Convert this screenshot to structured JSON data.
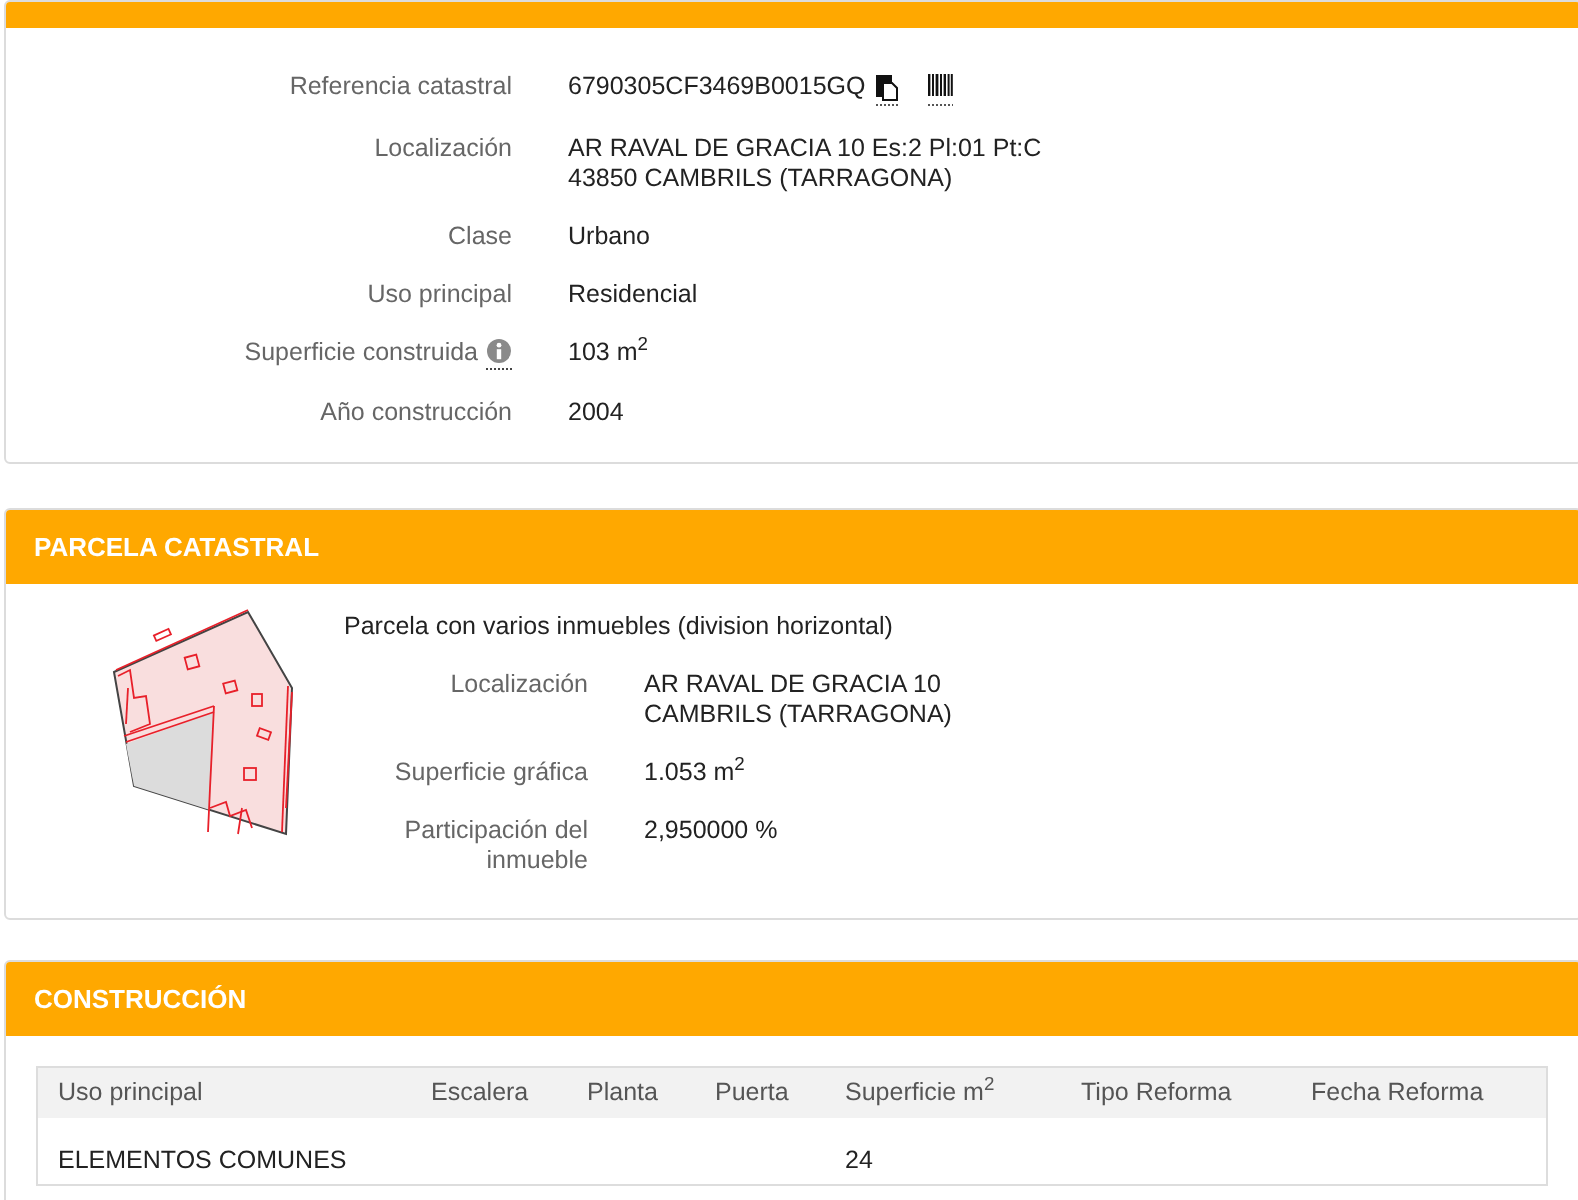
{
  "property": {
    "fields": [
      {
        "kind": "reference",
        "label": "Referencia catastral",
        "lines": [
          "6790305CF3469B0015GQ"
        ]
      },
      {
        "kind": "text",
        "label": "Localización",
        "lines": [
          "AR RAVAL DE GRACIA 10 Es:2 Pl:01 Pt:C",
          "43850 CAMBRILS (TARRAGONA)"
        ]
      },
      {
        "kind": "text",
        "label": "Clase",
        "lines": [
          "Urbano"
        ]
      },
      {
        "kind": "text",
        "label": "Uso principal",
        "lines": [
          "Residencial"
        ]
      },
      {
        "kind": "info",
        "label": "Superficie construida",
        "lines": [
          "103 m$^{2}$"
        ]
      },
      {
        "kind": "text",
        "label": "Año construcción",
        "lines": [
          "2004"
        ]
      }
    ]
  },
  "parcel": {
    "title": "PARCELA CATASTRAL",
    "description": "Parcela con varios inmuebles (division horizontal)",
    "fields": [
      {
        "label": "Localización",
        "lines": [
          "AR RAVAL DE GRACIA 10",
          "CAMBRILS (TARRAGONA)"
        ]
      },
      {
        "label": "Superficie gráfica",
        "lines": [
          "1.053 m$^{2}$"
        ]
      },
      {
        "label": "Participación del inmueble",
        "lines": [
          "2,950000 %"
        ]
      }
    ]
  },
  "construction": {
    "title": "CONSTRUCCIÓN",
    "table": {
      "columns": [
        "Uso principal",
        "Escalera",
        "Planta",
        "Puerta",
        "Superficie m$^{2}$",
        "Tipo Reforma",
        "Fecha Reforma"
      ],
      "rows": [
        {
          "cells": [
            "ELEMENTOS COMUNES",
            null,
            null,
            null,
            "24",
            null,
            null
          ]
        }
      ]
    }
  }
}
